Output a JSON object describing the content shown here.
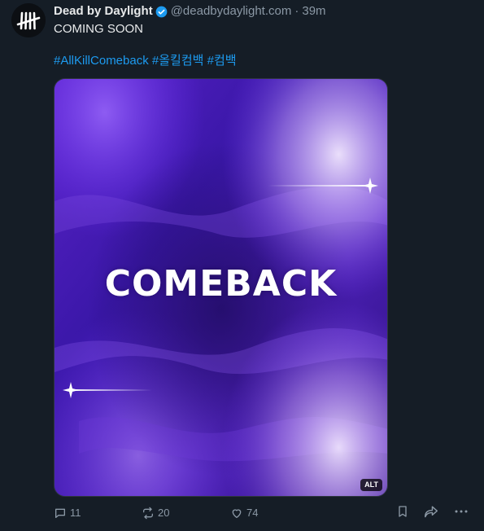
{
  "author": {
    "display_name": "Dead by Daylight",
    "handle": "@deadbydaylight.com",
    "separator": "·",
    "time": "39m",
    "verified_icon": "verified-badge-icon",
    "avatar_icon": "tally-marks-logo"
  },
  "post": {
    "text": "COMING SOON",
    "hashtags": [
      "#AllKillComeback",
      "#올킬컴백",
      "#컴백"
    ]
  },
  "media": {
    "title": "COMEBACK",
    "alt_label": "ALT"
  },
  "actions": {
    "reply": {
      "icon": "reply-icon",
      "count": "11"
    },
    "repost": {
      "icon": "repost-icon",
      "count": "20"
    },
    "like": {
      "icon": "heart-icon",
      "count": "74"
    },
    "bookmark": {
      "icon": "bookmark-icon"
    },
    "share": {
      "icon": "share-icon"
    },
    "more": {
      "icon": "more-icon"
    }
  },
  "colors": {
    "background": "#151d26",
    "link": "#1d9bf0",
    "muted": "#8b98a5",
    "text": "#e7e9ea",
    "verified": "#1d9bf0"
  }
}
